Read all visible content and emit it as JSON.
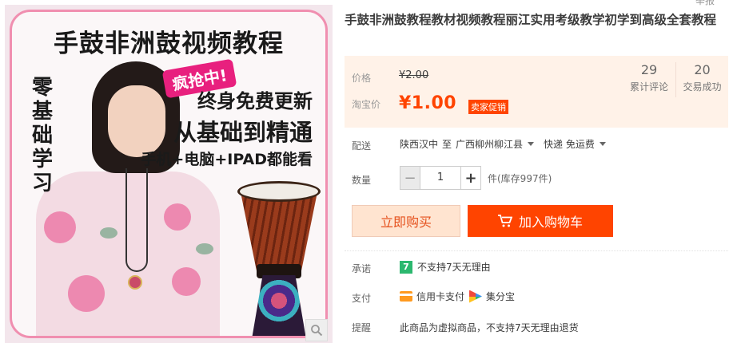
{
  "image": {
    "headline": "手鼓非洲鼓视频教程",
    "vertical_text": "零基础学习",
    "badge": "疯抢中!",
    "line1": "终身免费更新",
    "line2": "从基础到精通",
    "line3": "手机+电脑+IPAD都能看",
    "zoom_icon": "search-icon"
  },
  "header": {
    "corner_text": "举报"
  },
  "product": {
    "title": "手鼓非洲鼓教程教材视频教程丽江实用考级教学初学到高级全套教程"
  },
  "price": {
    "orig_label": "价格",
    "orig_value": "¥2.00",
    "now_label": "淘宝价",
    "now_value": "¥1.00",
    "promo_tag": "卖家促销",
    "stats": [
      {
        "num": "29",
        "label": "累计评论"
      },
      {
        "num": "20",
        "label": "交易成功"
      }
    ]
  },
  "shipping": {
    "label": "配送",
    "from": "陕西汉中",
    "to_word": "至",
    "to": "广西柳州柳江县",
    "method": "快递 免运费"
  },
  "quantity": {
    "label": "数量",
    "value": "1",
    "minus": "−",
    "plus": "+",
    "stock": "件(库存997件)"
  },
  "actions": {
    "buy_now": "立即购买",
    "add_cart": "加入购物车"
  },
  "promise": {
    "label": "承诺",
    "icon_text": "7",
    "text": "不支持7天无理由"
  },
  "payment": {
    "label": "支付",
    "methods": [
      "信用卡支付",
      "集分宝"
    ]
  },
  "tip": {
    "label": "提醒",
    "text": "此商品为虚拟商品，不支持7天无理由退货"
  },
  "colors": {
    "accent": "#ff4400",
    "price": "#ff4400",
    "price_bg": "#fff2e8",
    "image_border": "#f08fb0"
  }
}
